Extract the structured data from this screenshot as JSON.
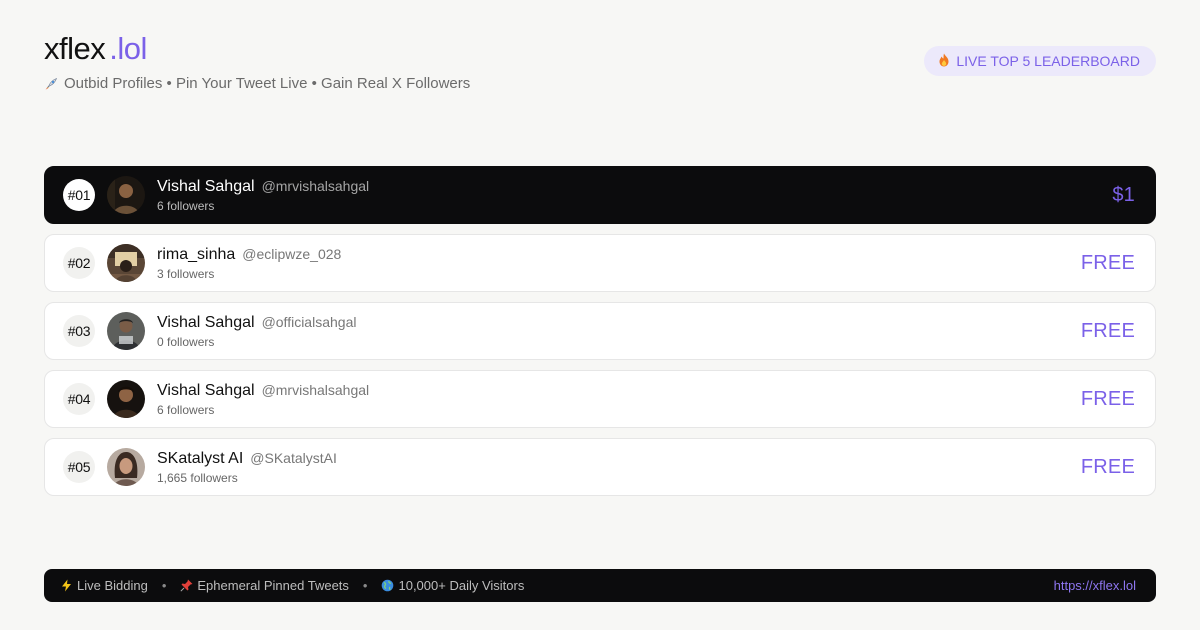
{
  "brand": {
    "name": "xflex",
    "tld": ".lol"
  },
  "tagline": "Outbid Profiles • Pin Your Tweet Live • Gain Real X Followers",
  "live_badge": "LIVE TOP 5 LEADERBOARD",
  "colors": {
    "accent": "#7b61e8",
    "dark": "#0c0c0d",
    "background": "#f7f7f5"
  },
  "leaderboard": [
    {
      "rank": "#01",
      "name": "Vishal Sahgal",
      "handle": "@mrvishalsahgal",
      "followers": "6 followers",
      "price": "$1",
      "avatar": "avatar-photo"
    },
    {
      "rank": "#02",
      "name": "rima_sinha",
      "handle": "@eclipwze_028",
      "followers": "3 followers",
      "price": "FREE",
      "avatar": "avatar-photo"
    },
    {
      "rank": "#03",
      "name": "Vishal Sahgal",
      "handle": "@officialsahgal",
      "followers": "0 followers",
      "price": "FREE",
      "avatar": "avatar-photo"
    },
    {
      "rank": "#04",
      "name": "Vishal Sahgal",
      "handle": "@mrvishalsahgal",
      "followers": "6 followers",
      "price": "FREE",
      "avatar": "avatar-photo"
    },
    {
      "rank": "#05",
      "name": "SKatalyst AI",
      "handle": "@SKatalystAI",
      "followers": "1,665 followers",
      "price": "FREE",
      "avatar": "avatar-photo"
    }
  ],
  "footer": {
    "items": [
      {
        "icon": "lightning-icon",
        "label": "Live Bidding"
      },
      {
        "icon": "pin-icon",
        "label": "Ephemeral Pinned Tweets"
      },
      {
        "icon": "globe-icon",
        "label": "10,000+ Daily Visitors"
      }
    ],
    "separator": "•",
    "url": "https://xflex.lol"
  }
}
